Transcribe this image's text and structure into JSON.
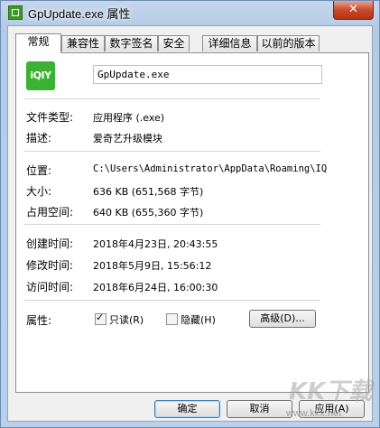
{
  "window": {
    "title": "GpUpdate.exe 属性",
    "close_glyph": "✕"
  },
  "tabs": [
    "常规",
    "兼容性",
    "数字签名",
    "安全",
    "详细信息",
    "以前的版本"
  ],
  "app_icon_text": "iQIY",
  "filename": "GpUpdate.exe",
  "fields": {
    "type_label": "文件类型:",
    "type_value": "应用程序 (.exe)",
    "desc_label": "描述:",
    "desc_value": "爱奇艺升级模块",
    "location_label": "位置:",
    "location_value": "C:\\Users\\Administrator\\AppData\\Roaming\\IQ",
    "size_label": "大小:",
    "size_value": "636 KB (651,568 字节)",
    "disk_label": "占用空间:",
    "disk_value": "640 KB (655,360 字节)",
    "created_label": "创建时间:",
    "created_value": "2018年4月23日, 20:43:55",
    "modified_label": "修改时间:",
    "modified_value": "2018年5月9日, 15:56:12",
    "accessed_label": "访问时间:",
    "accessed_value": "2018年6月24日, 16:00:30",
    "attr_label": "属性:"
  },
  "attributes": {
    "readonly_label": "只读(R)",
    "readonly_checked": true,
    "hidden_label": "隐藏(H)",
    "hidden_checked": false,
    "advanced_label": "高级(D)..."
  },
  "buttons": {
    "ok": "确定",
    "cancel": "取消",
    "apply": "应用(A)"
  },
  "watermark": {
    "logo": "KK下载",
    "url": "www.kkx.net"
  }
}
